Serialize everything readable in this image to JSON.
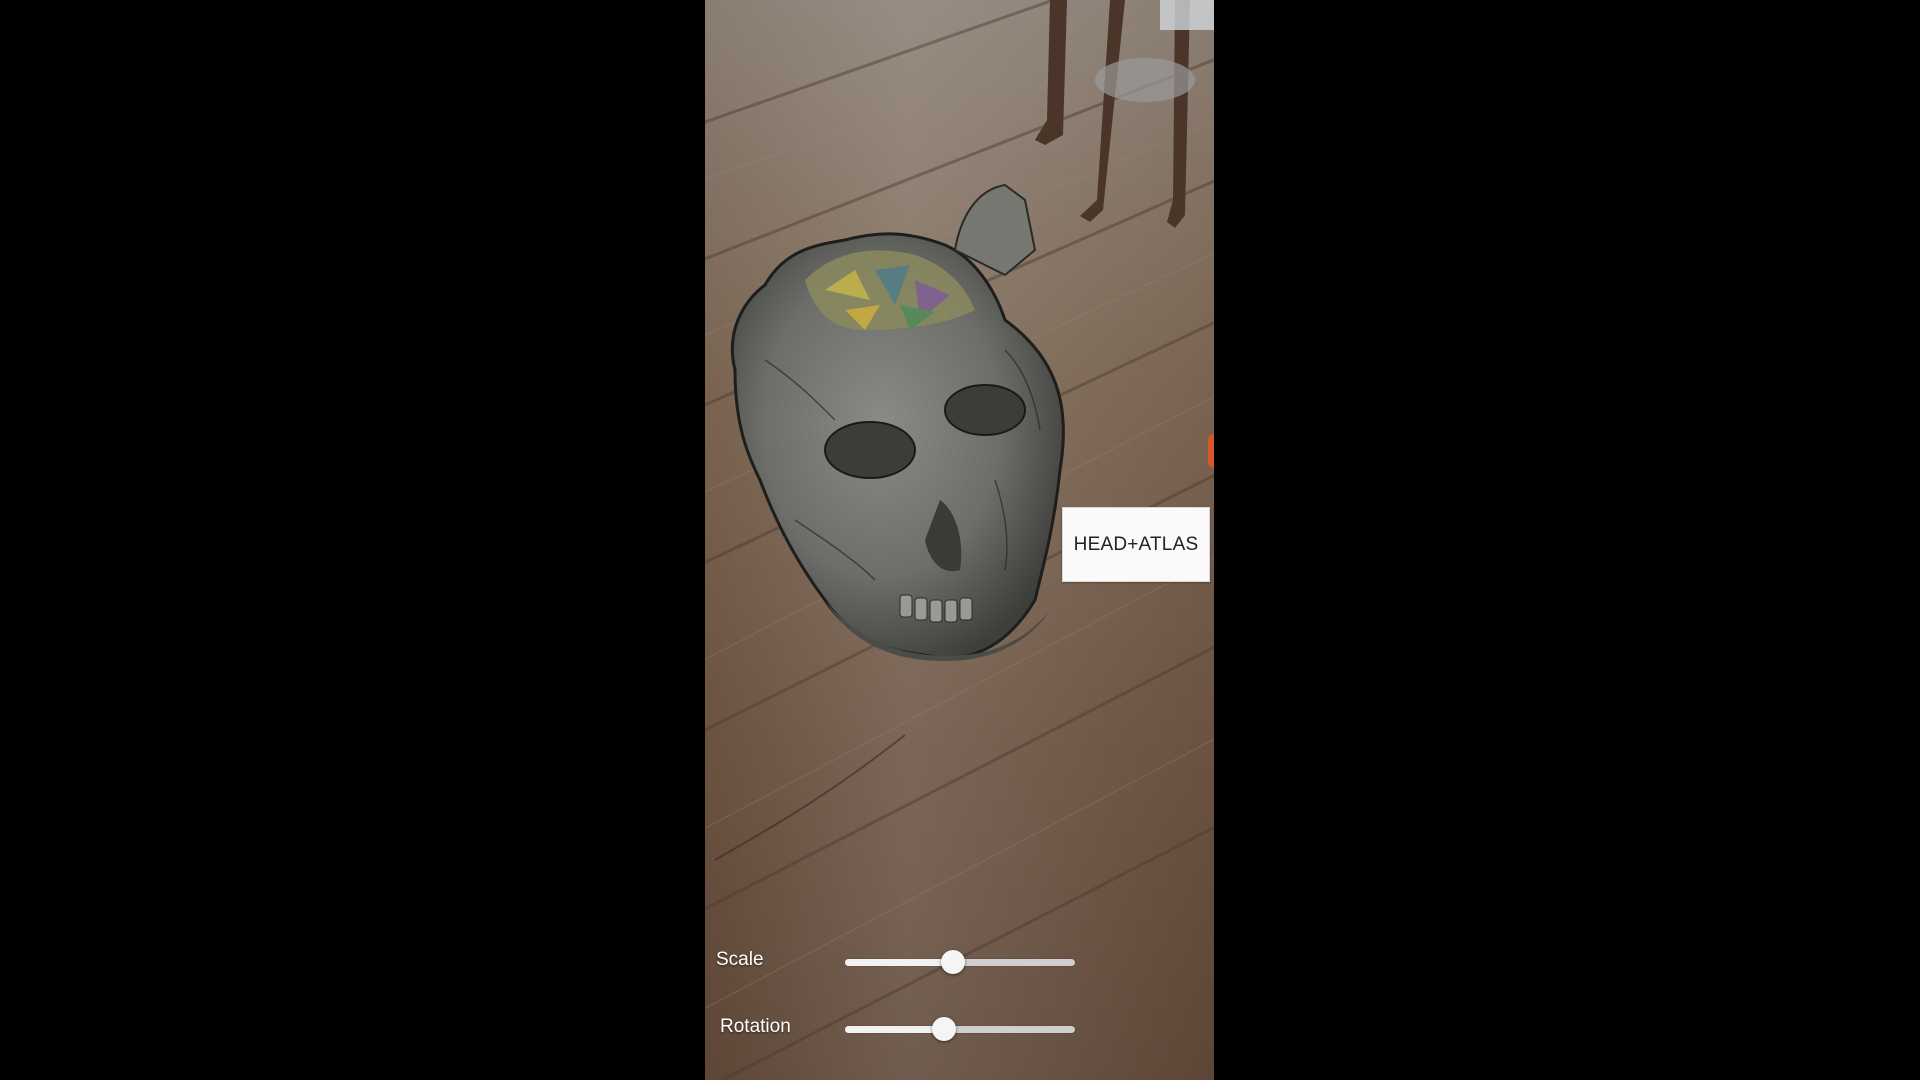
{
  "ar_view": {
    "model_button_label": "HEAD+ATLAS",
    "scale": {
      "label": "Scale",
      "value": 0.47
    },
    "rotation": {
      "label": "Rotation",
      "value": 0.43
    }
  },
  "colors": {
    "background": "#000000",
    "button_background": "#fafafa",
    "slider_track": "#cfcfcf",
    "slider_handle": "#f5f5f5",
    "label_text": "#ffffff"
  }
}
